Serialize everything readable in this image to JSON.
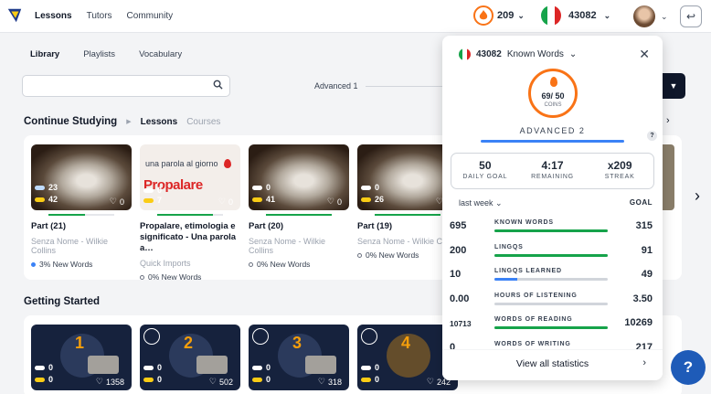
{
  "nav": {
    "lessons": "Lessons",
    "tutors": "Tutors",
    "community": "Community"
  },
  "header": {
    "streak_coins": "209",
    "known_words": "43082"
  },
  "subtabs": {
    "library": "Library",
    "playlists": "Playlists",
    "vocabulary": "Vocabulary"
  },
  "search": {
    "placeholder": ""
  },
  "level_filter": {
    "label": "Advanced 1"
  },
  "continue": {
    "title": "Continue Studying",
    "tab_lessons": "Lessons",
    "tab_courses": "Courses",
    "cards": [
      {
        "blue": "23",
        "yellow": "42",
        "likes": "0",
        "title": "Part (21)",
        "author": "Senza Nome - Wilkie Collins",
        "words": "3% New Words",
        "progress": 0.55
      },
      {
        "blue": "0",
        "yellow": "7",
        "likes": "0",
        "title": "Propalare, etimologia e significato - Una parola a…",
        "author": "Quick Imports",
        "words": "0% New Words",
        "progress": 0.85,
        "promo_line": "una parola al giorno",
        "promo_word": "Propalare"
      },
      {
        "blue": "0",
        "yellow": "41",
        "likes": "0",
        "title": "Part (20)",
        "author": "Senza Nome - Wilkie Collins",
        "words": "0% New Words",
        "progress": 1.0
      },
      {
        "blue": "0",
        "yellow": "26",
        "likes": "0",
        "title": "Part (19)",
        "author": "Senza Nome - Wilkie C",
        "words": "0% New Words",
        "progress": 1.0
      }
    ]
  },
  "getting_started": {
    "title": "Getting Started",
    "cards": [
      {
        "num": "1",
        "blue": "0",
        "yellow": "0",
        "count": "1358"
      },
      {
        "num": "2",
        "blue": "0",
        "yellow": "0",
        "count": "502"
      },
      {
        "num": "3",
        "blue": "0",
        "yellow": "0",
        "count": "318"
      },
      {
        "num": "4",
        "blue": "0",
        "yellow": "0",
        "count": "242"
      }
    ]
  },
  "stats_popup": {
    "known_words": "43082",
    "known_words_label": "Known Words",
    "coins_value": "69/ 50",
    "coins_label": "COINS",
    "level": "ADVANCED 2",
    "help": "?",
    "daily_goal": "50",
    "daily_goal_label": "DAILY GOAL",
    "remaining": "4:17",
    "remaining_label": "REMAINING",
    "streak": "x209",
    "streak_label": "STREAK",
    "period": "last week",
    "goal_header": "GOAL",
    "rows": [
      {
        "value": "695",
        "label": "KNOWN WORDS",
        "goal": "315",
        "fill": 1.0,
        "color": "green"
      },
      {
        "value": "200",
        "label": "LINGQS",
        "goal": "91",
        "fill": 1.0,
        "color": "green"
      },
      {
        "value": "10",
        "label": "LINGQS LEARNED",
        "goal": "49",
        "fill": 0.2,
        "color": "blue"
      },
      {
        "value": "0.00",
        "label": "HOURS OF LISTENING",
        "goal": "3.50",
        "fill": 0.0,
        "color": "green"
      },
      {
        "value": "10713",
        "label": "WORDS OF READING",
        "goal": "10269",
        "fill": 1.0,
        "color": "green"
      },
      {
        "value": "0",
        "label": "WORDS OF WRITING",
        "goal": "217",
        "fill": 0.0,
        "color": "green"
      }
    ],
    "view_all": "View all statistics"
  },
  "help_fab": "?",
  "colors": {
    "accent_blue": "#3b82f6",
    "streak_orange": "#f97316",
    "progress_green": "#16a34a",
    "italy_green": "#16a34a",
    "italy_white": "#ffffff",
    "italy_red": "#dc2626"
  }
}
